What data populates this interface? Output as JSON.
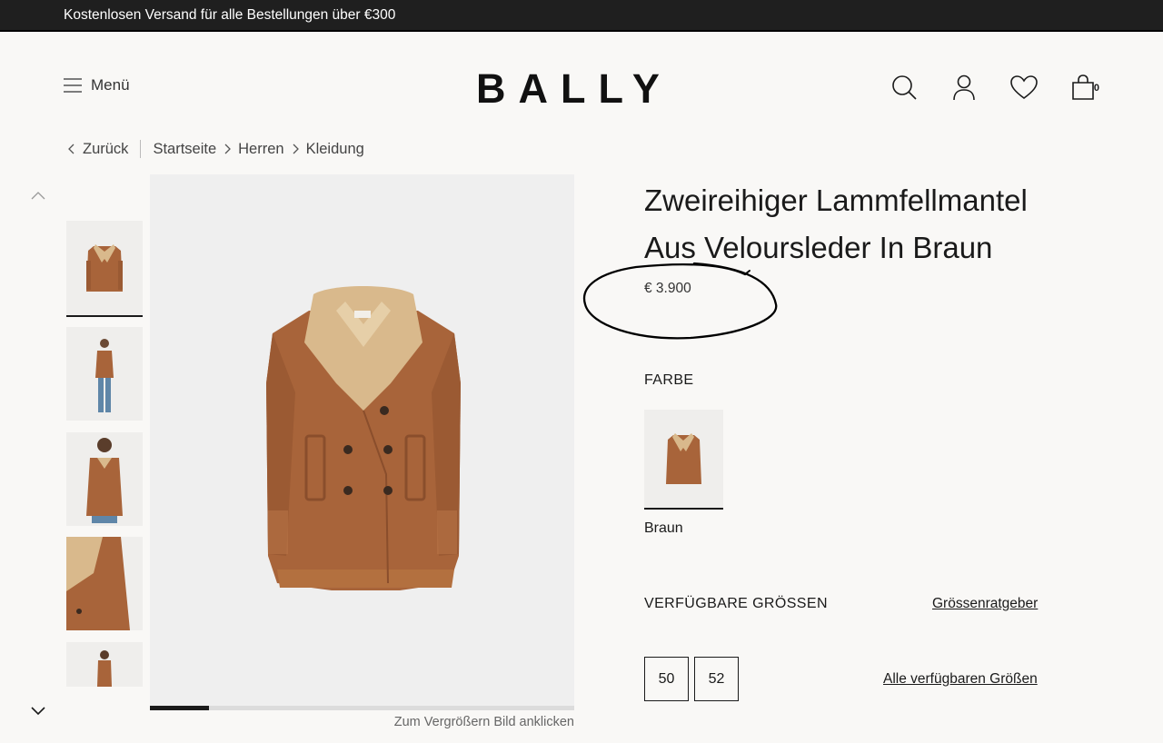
{
  "promo": {
    "text": "Kostenlosen Versand für alle Bestellungen über €300"
  },
  "header": {
    "menu_label": "Menü",
    "logo": "BALLY",
    "icons": [
      "search-icon",
      "account-icon",
      "wishlist-heart-icon",
      "shopping-bag-icon"
    ],
    "bag_count": "0"
  },
  "breadcrumb": {
    "back_label": "Zurück",
    "items": [
      "Startseite",
      "Herren",
      "Kleidung"
    ]
  },
  "product": {
    "title": "Zweireihiger Lammfellmantel Aus Veloursleder In Braun",
    "price": "€ 3.900",
    "color_heading": "FARBE",
    "color_selected": "Braun",
    "sizes_heading": "VERFÜGBARE GRÖSSEN",
    "size_guide_label": "Grössenratgeber",
    "sizes": [
      "50",
      "52"
    ],
    "all_sizes_label": "Alle verfügbaren Größen"
  },
  "gallery": {
    "zoom_hint": "Zum Vergrößern Bild anklicken",
    "progress": 0.14,
    "thumbnail_count": 5
  },
  "colors": {
    "coat": "#a8643a",
    "shearling": "#d9b98c",
    "dark": "#1a1a1a",
    "annotation": "#000000"
  }
}
